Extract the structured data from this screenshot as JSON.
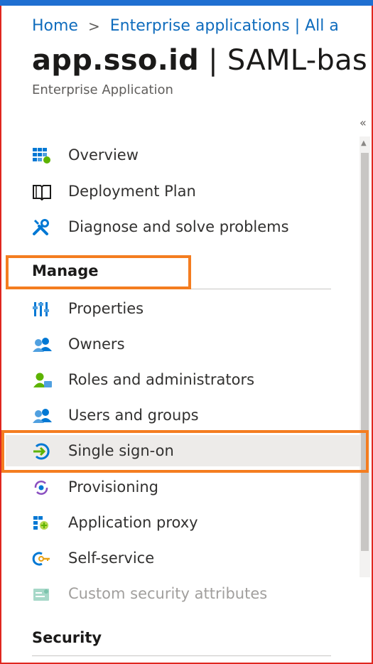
{
  "breadcrumb": {
    "items": [
      "Home",
      "Enterprise applications | All a"
    ],
    "separator": ">"
  },
  "header": {
    "app_name": "app.sso.id",
    "title_rest": " | SAML-bas",
    "subtitle": "Enterprise Application",
    "collapse_glyph": "«"
  },
  "nav": {
    "top_items": [
      {
        "label": "Overview",
        "icon": "overview-grid-icon"
      },
      {
        "label": "Deployment Plan",
        "icon": "book-icon"
      },
      {
        "label": "Diagnose and solve problems",
        "icon": "wrench-icon"
      }
    ],
    "manage_section": "Manage",
    "manage_items": [
      {
        "label": "Properties",
        "icon": "properties-icon"
      },
      {
        "label": "Owners",
        "icon": "owners-icon"
      },
      {
        "label": "Roles and administrators",
        "icon": "roles-icon"
      },
      {
        "label": "Users and groups",
        "icon": "users-groups-icon"
      },
      {
        "label": "Single sign-on",
        "icon": "sso-icon",
        "selected": true
      },
      {
        "label": "Provisioning",
        "icon": "provisioning-icon"
      },
      {
        "label": "Application proxy",
        "icon": "app-proxy-icon"
      },
      {
        "label": "Self-service",
        "icon": "self-service-icon"
      },
      {
        "label": "Custom security attributes",
        "icon": "custom-attributes-icon",
        "disabled": true
      }
    ],
    "security_section": "Security"
  },
  "colors": {
    "link": "#0f6cbd",
    "highlight": "#f47d20",
    "frame": "#e0271f",
    "selected_bg": "#edebe9"
  }
}
